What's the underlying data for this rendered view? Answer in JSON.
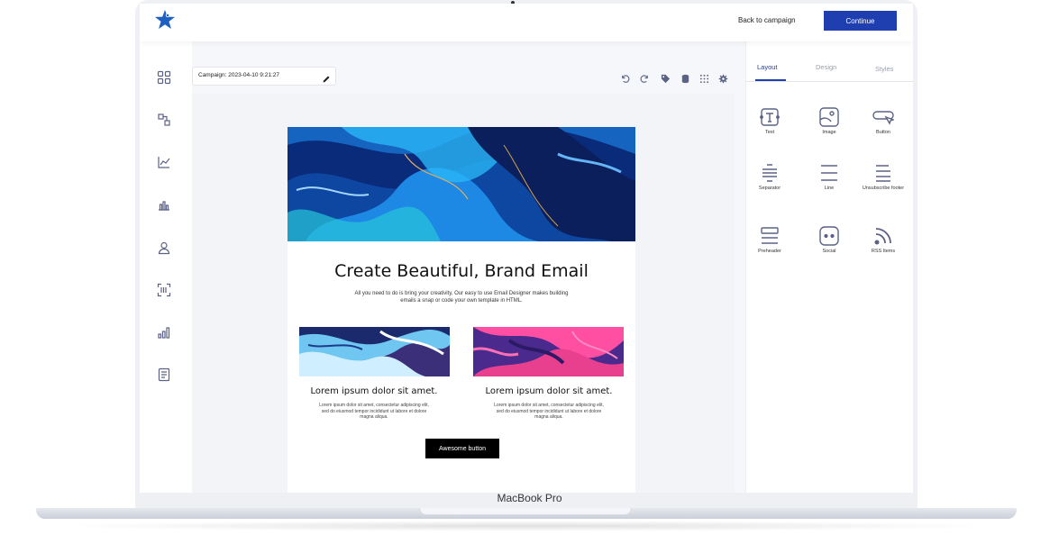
{
  "device": {
    "model_label": "MacBook Pro"
  },
  "header": {
    "back_label": "Back to campaign",
    "continue_label": "Continue"
  },
  "editor": {
    "campaign_name": "Campaign: 2023-04-10 9:21:27"
  },
  "panel": {
    "tabs": [
      {
        "label": "Layout",
        "active": true
      },
      {
        "label": "Design",
        "active": false
      },
      {
        "label": "Styles",
        "active": false
      }
    ],
    "widgets": [
      {
        "label": "Text",
        "icon": "text-block-icon"
      },
      {
        "label": "Image",
        "icon": "image-block-icon"
      },
      {
        "label": "Button",
        "icon": "button-block-icon"
      },
      {
        "label": "Separator",
        "icon": "separator-block-icon"
      },
      {
        "label": "Line",
        "icon": "line-block-icon"
      },
      {
        "label": "Unsubscribe footer",
        "icon": "unsubscribe-footer-icon"
      },
      {
        "label": "Preheader",
        "icon": "preheader-block-icon"
      },
      {
        "label": "Social",
        "icon": "social-block-icon"
      },
      {
        "label": "RSS Items",
        "icon": "rss-block-icon"
      }
    ]
  },
  "email": {
    "title": "Create Beautiful, Brand Email",
    "subtitle": "All you need to do is bring your creativity, Our easy to use Email Designer makes building emails a snap or code your own template in HTML.",
    "columns": [
      {
        "heading": "Lorem ipsum dolor sit amet.",
        "body": "Lorem ipsum dolor sit amet, consectetur adipiscing elit, sed do eiusmod tempor incididunt ut labore et dolore magna aliqua."
      },
      {
        "heading": "Lorem ipsum dolor sit amet.",
        "body": "Lorem ipsum dolor sit amet, consectetur adipiscing elit, sed do eiusmod tempor incididunt ut labore et dolore magna aliqua."
      }
    ],
    "button_label": "Awesome button"
  },
  "colors": {
    "accent": "#1f3fb0",
    "icon": "#5c6285",
    "button": "#000000"
  }
}
